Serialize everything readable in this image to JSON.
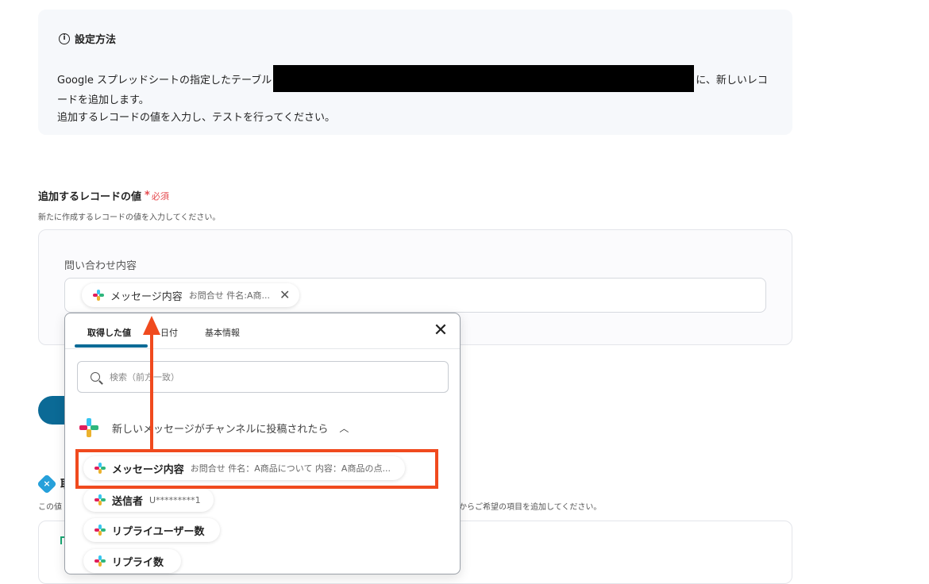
{
  "info": {
    "title": "設定方法",
    "line1_before": "Google スプレッドシートの指定したテーブル",
    "line1_after": "に、新しいレコ",
    "line2": "ードを追加します。",
    "line3": "追加するレコードの値を入力し、テストを行ってください。"
  },
  "field": {
    "label": "追加するレコードの値",
    "required_star": "*",
    "required_text": "必須",
    "help": "新たに作成するレコードの値を入力してください。",
    "sub_label": "問い合わせ内容",
    "chip": {
      "name": "メッセージ内容",
      "value": "お問合せ 件名:A商..."
    }
  },
  "background": {
    "heading_fragment": "取",
    "help_left": "この値",
    "help_right": "からご希望の項目を追加してください。"
  },
  "dropdown": {
    "tabs": [
      {
        "label": "取得した値",
        "active": true
      },
      {
        "label": "日付",
        "active": false
      },
      {
        "label": "基本情報",
        "active": false
      }
    ],
    "search": {
      "placeholder": "検索（前方一致）",
      "value": ""
    },
    "group_title": "新しいメッセージがチャンネルに投稿されたら",
    "items": [
      {
        "name": "メッセージ内容",
        "value": "お問合せ 件名：A商品について 内容：A商品の点..."
      },
      {
        "name": "送信者",
        "value": "U*********1"
      },
      {
        "name": "リプライユーザー数",
        "value": ""
      },
      {
        "name": "リプライ数",
        "value": ""
      }
    ]
  },
  "colors": {
    "accent": "#0b6a96",
    "annotation": "#f04a1e",
    "required": "#e5484d"
  }
}
